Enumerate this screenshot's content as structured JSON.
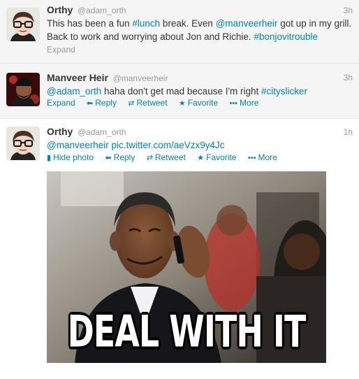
{
  "tweets": [
    {
      "name": "Orthy",
      "handle": "@adam_orth",
      "time": "3h",
      "text_parts": [
        "This has been a fun ",
        "#lunch",
        " break. Even ",
        "@manveerheir",
        " got up in my grill. Back to work and worrying about Jon and Richie. ",
        "#bonjovitrouble"
      ],
      "actions": {
        "expand": "Expand"
      }
    },
    {
      "name": "Manveer Heir",
      "handle": "@manveerheir",
      "time": "3h",
      "text_parts": [
        "@adam_orth",
        " haha don't get mad because I'm right ",
        "#cityslicker"
      ],
      "actions": {
        "expand": "Expand",
        "reply": "Reply",
        "retweet": "Retweet",
        "favorite": "Favorite",
        "more": "More"
      }
    },
    {
      "name": "Orthy",
      "handle": "@adam_orth",
      "time": "1h",
      "text_parts": [
        "@manveerheir",
        " pic.twitter.com/aeVzx9y4Jc"
      ],
      "actions": {
        "hide_photo": "Hide photo",
        "reply": "Reply",
        "retweet": "Retweet",
        "favorite": "Favorite",
        "more": "More"
      },
      "media_caption": "DEAL WITH IT"
    }
  ],
  "icons": {
    "reply": "reply-arrow-icon",
    "retweet": "retweet-icon",
    "favorite": "star-icon",
    "more": "dots-icon",
    "media": "photo-icon"
  },
  "colors": {
    "link": "#0084b4",
    "meta": "#999999",
    "text": "#333333",
    "expanded_bg": "#f5f5f5"
  }
}
